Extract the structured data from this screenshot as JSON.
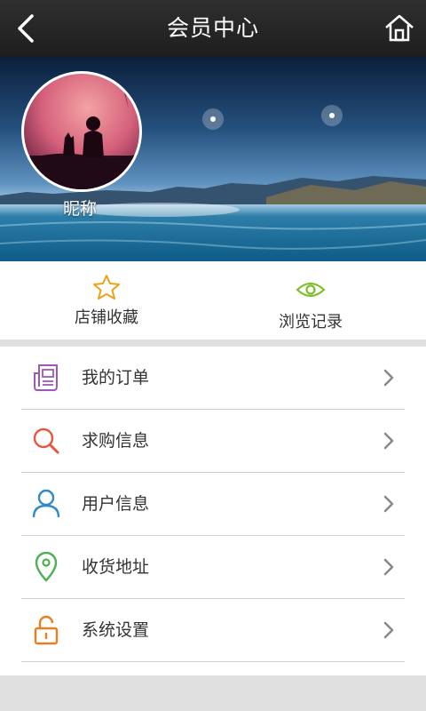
{
  "header": {
    "title": "会员中心",
    "back_icon": "back-arrow-icon",
    "home_icon": "home-icon"
  },
  "profile": {
    "nickname": "昵称"
  },
  "quick_actions": [
    {
      "label": "店铺收藏",
      "icon": "star-icon",
      "color": "#e8a317"
    },
    {
      "label": "浏览记录",
      "icon": "eye-icon",
      "color": "#7cbf2a"
    }
  ],
  "menu": [
    {
      "label": "我的订单",
      "icon": "orders-icon",
      "color": "#9b59b6"
    },
    {
      "label": "求购信息",
      "icon": "search-icon",
      "color": "#e8543e"
    },
    {
      "label": "用户信息",
      "icon": "user-icon",
      "color": "#2e8bc9"
    },
    {
      "label": "收货地址",
      "icon": "location-pin-icon",
      "color": "#4caf50"
    },
    {
      "label": "系统设置",
      "icon": "unlock-icon",
      "color": "#e67e22"
    }
  ]
}
